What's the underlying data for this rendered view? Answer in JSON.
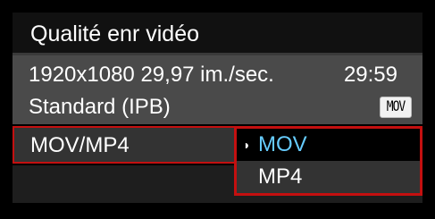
{
  "header": {
    "title": "Qualité enr vidéo"
  },
  "info": {
    "resolution_framerate": "1920x1080 29,97 im./sec.",
    "time_remaining": "29:59",
    "compression": "Standard (IPB)",
    "format_badge": "MOV"
  },
  "menu": {
    "row_label": "MOV/MP4",
    "options": [
      {
        "label": "MOV",
        "selected": true,
        "caret": "◗"
      },
      {
        "label": "MP4",
        "selected": false
      }
    ]
  },
  "colors": {
    "accent_red": "#c41010",
    "selected_text": "#66ccff",
    "panel_gray": "#4a4a4a",
    "row_gray": "#333333",
    "background": "#000000"
  }
}
